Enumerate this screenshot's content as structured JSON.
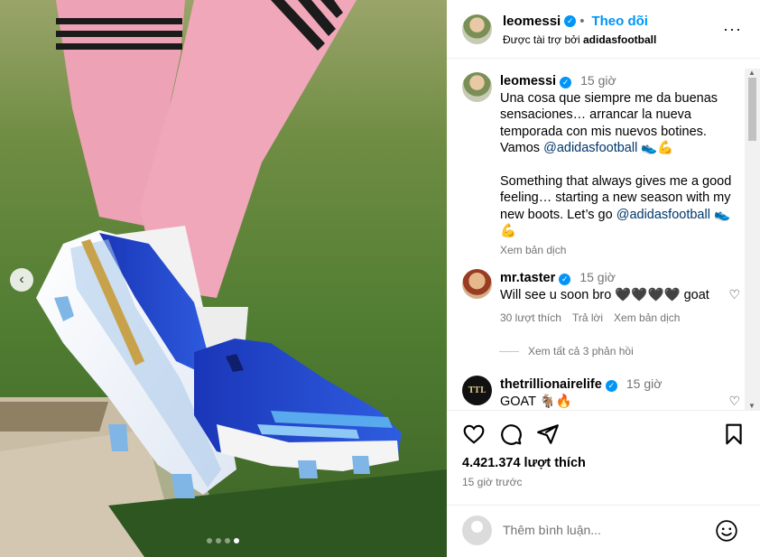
{
  "post": {
    "author": "leomessi",
    "follow_label": "Theo dõi",
    "separator": "•",
    "sponsor_prefix": "Được tài trợ bởi",
    "sponsor_brand": "adidasfootball",
    "more_label": "···"
  },
  "caption": {
    "author": "leomessi",
    "time": "15 giờ",
    "text_es": "Una cosa que siempre me da buenas sensaciones… arrancar la nueva temporada con mis nuevos botines. Vamos",
    "mention": "@adidasfootball",
    "emoji": "👟💪",
    "text_en": "Something that always gives me a good feeling… starting a new season with my new boots. Let’s go",
    "translate": "Xem bản dịch"
  },
  "comments": [
    {
      "author": "mr.taster",
      "time": "15 giờ",
      "text": "Will see u soon bro 🖤🖤🖤🖤 goat",
      "likes": "30 lượt thích",
      "reply": "Trả lời",
      "translate": "Xem bản dịch"
    },
    {
      "author": "thetrillionairelife",
      "avatar_text": "TTL",
      "time": "15 giờ",
      "text": "GOAT 🐐🔥"
    }
  ],
  "view_replies": "Xem tất cả 3 phản hồi",
  "likes_count": "4.421.374 lượt thích",
  "posted_ago": "15 giờ trước",
  "add_comment": {
    "placeholder": "Thêm bình luận..."
  },
  "icons": [
    "heart-icon",
    "comment-icon",
    "share-icon",
    "bookmark-icon",
    "emoji-icon",
    "chevron-left-icon",
    "verified-icon"
  ],
  "colors": {
    "accent": "#0095f6",
    "link": "#00376b",
    "muted": "#737373"
  },
  "carousel": {
    "count": 4,
    "active": 4
  }
}
